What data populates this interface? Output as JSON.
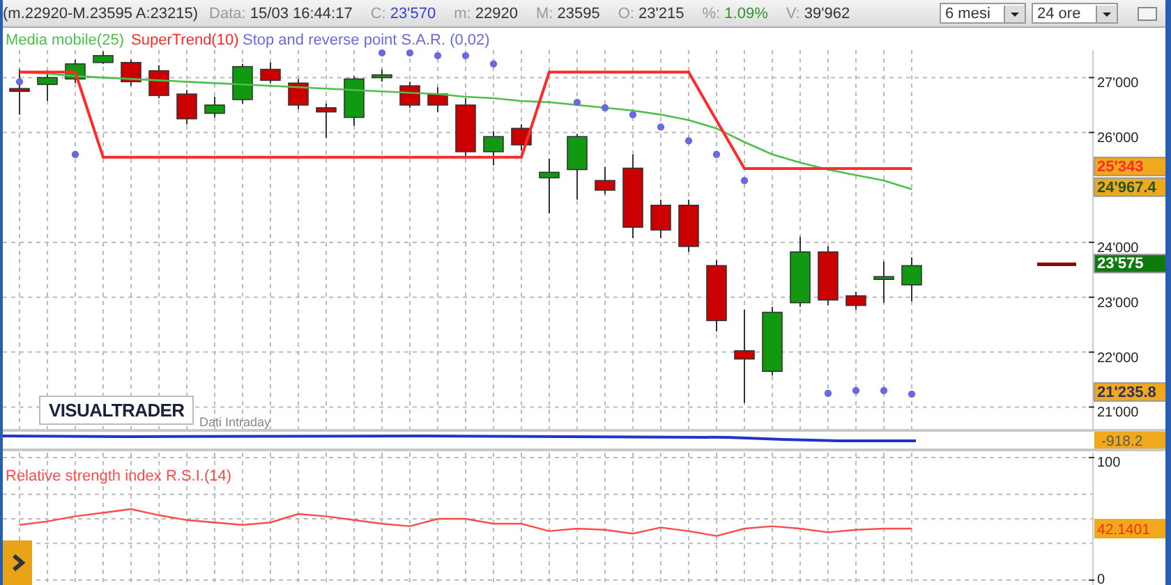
{
  "header": {
    "range": "(m.22920-M.23595 A:23215)",
    "fields": [
      {
        "label": "Data:",
        "value": "15/03 16:44:17",
        "kind": "plain"
      },
      {
        "label": "C:",
        "value": "23'570",
        "kind": "price"
      },
      {
        "label": "m:",
        "value": "22920",
        "kind": "plain"
      },
      {
        "label": "M:",
        "value": "23595",
        "kind": "plain"
      },
      {
        "label": "O:",
        "value": "23'215",
        "kind": "plain"
      },
      {
        "label": "%:",
        "value": "1.09%",
        "kind": "change"
      },
      {
        "label": "V:",
        "value": "39'962",
        "kind": "plain"
      }
    ],
    "dropdowns": [
      {
        "value": "6 mesi"
      },
      {
        "value": "24 ore"
      }
    ]
  },
  "price_chart": {
    "chart_data": {
      "type": "candlestick",
      "grid": true,
      "ylim": [
        20600,
        27500
      ],
      "yticks": [
        {
          "value": 21000,
          "label": "21'000"
        },
        {
          "value": 22000,
          "label": "22'000"
        },
        {
          "value": 23000,
          "label": "23'000"
        },
        {
          "value": 24000,
          "label": "24'000"
        },
        {
          "value": 26000,
          "label": "26'000"
        },
        {
          "value": 27000,
          "label": "27'000"
        }
      ],
      "ohlc": [
        [
          26800,
          27150,
          26325,
          26750
        ],
        [
          26875,
          27125,
          26575,
          27000
        ],
        [
          26975,
          27325,
          26900,
          27250
        ],
        [
          27275,
          27475,
          27250,
          27400
        ],
        [
          27275,
          27325,
          26850,
          26925
        ],
        [
          27125,
          27225,
          26625,
          26675
        ],
        [
          26700,
          26775,
          26150,
          26250
        ],
        [
          26350,
          26650,
          26275,
          26500
        ],
        [
          26600,
          27250,
          26525,
          27200
        ],
        [
          27150,
          27275,
          26900,
          26950
        ],
        [
          26900,
          26975,
          26425,
          26500
        ],
        [
          26450,
          26525,
          25900,
          26375
        ],
        [
          26275,
          27025,
          26125,
          26975
        ],
        [
          27000,
          27150,
          26925,
          27050
        ],
        [
          26850,
          26925,
          26450,
          26500
        ],
        [
          26700,
          26825,
          26375,
          26500
        ],
        [
          26500,
          26625,
          25575,
          25650
        ],
        [
          25650,
          26025,
          25400,
          25925
        ],
        [
          26075,
          26150,
          25675,
          25775
        ],
        [
          25175,
          25525,
          24525,
          25275
        ],
        [
          25325,
          25975,
          24775,
          25925
        ],
        [
          25125,
          25375,
          24875,
          24950
        ],
        [
          25350,
          25600,
          24075,
          24275
        ],
        [
          24675,
          24775,
          24075,
          24225
        ],
        [
          24675,
          24775,
          23825,
          23925
        ],
        [
          23575,
          23675,
          22375,
          22575
        ],
        [
          22025,
          22775,
          21075,
          21875
        ],
        [
          21650,
          22825,
          21575,
          22725
        ],
        [
          22900,
          24100,
          22825,
          23825
        ],
        [
          23825,
          23925,
          22850,
          22950
        ],
        [
          23025,
          23100,
          22775,
          22850
        ],
        [
          23325,
          23650,
          22900,
          23375
        ],
        [
          23225,
          23725,
          22925,
          23575
        ]
      ],
      "series": [
        {
          "name": "Media mobile(25)",
          "type": "line",
          "color": "#4cbf4c",
          "values": [
            27100,
            27075,
            27025,
            27000,
            26975,
            26950,
            26925,
            26900,
            26875,
            26850,
            26825,
            26800,
            26775,
            26750,
            26725,
            26700,
            26650,
            26625,
            26575,
            26550,
            26500,
            26450,
            26400,
            26325,
            26225,
            26075,
            25825,
            25600,
            25450,
            25325,
            25225,
            25125,
            24967
          ]
        },
        {
          "name": "SuperTrend(10)",
          "type": "line",
          "color": "#ff2a2a",
          "values": [
            27100,
            27100,
            27100,
            25550,
            25550,
            25550,
            25550,
            25550,
            25550,
            25550,
            25550,
            25550,
            25550,
            25550,
            25550,
            25550,
            25550,
            25550,
            25550,
            27100,
            27100,
            27100,
            27100,
            27100,
            27100,
            26220,
            25343,
            25343,
            25343,
            25343,
            25343,
            25343,
            25343
          ]
        },
        {
          "name": "Stop and reverse point S.A.R. (0,02)",
          "type": "scatter",
          "color": "#6a6ae0",
          "values": [
            26925,
            null,
            25600,
            null,
            null,
            null,
            null,
            null,
            null,
            null,
            null,
            null,
            null,
            27450,
            27450,
            27400,
            27400,
            27250,
            null,
            null,
            26550,
            26450,
            26325,
            26100,
            25850,
            25600,
            25125,
            null,
            null,
            21250,
            21300,
            21300,
            21236
          ]
        }
      ]
    },
    "price_labels": [
      {
        "text": "25'343",
        "kind": "supertrend"
      },
      {
        "text": "24'967.4",
        "kind": "ma"
      },
      {
        "text": "23'575",
        "kind": "close"
      },
      {
        "text": "21'235.8",
        "kind": "sar"
      }
    ]
  },
  "logo": {
    "text": "VISUALTRADER",
    "caption": "Dati Intraday"
  },
  "oscillator": {
    "label": "-918.2"
  },
  "rsi_chart": {
    "chart_data": {
      "type": "line",
      "grid": true,
      "ylim": [
        -4,
        104
      ],
      "yticks": [
        0,
        100
      ],
      "series": [
        {
          "name": "Relative strength index R.S.I.(14)",
          "color": "#ff4a4a",
          "values": [
            45,
            48,
            52,
            55,
            58,
            53,
            49,
            47,
            45,
            47,
            54,
            52,
            49,
            46,
            44,
            50,
            50,
            46,
            46,
            40,
            42,
            41,
            38,
            43,
            40,
            36,
            42,
            44,
            42,
            39,
            41,
            42,
            42
          ]
        }
      ]
    },
    "value_label": "42.1401"
  }
}
